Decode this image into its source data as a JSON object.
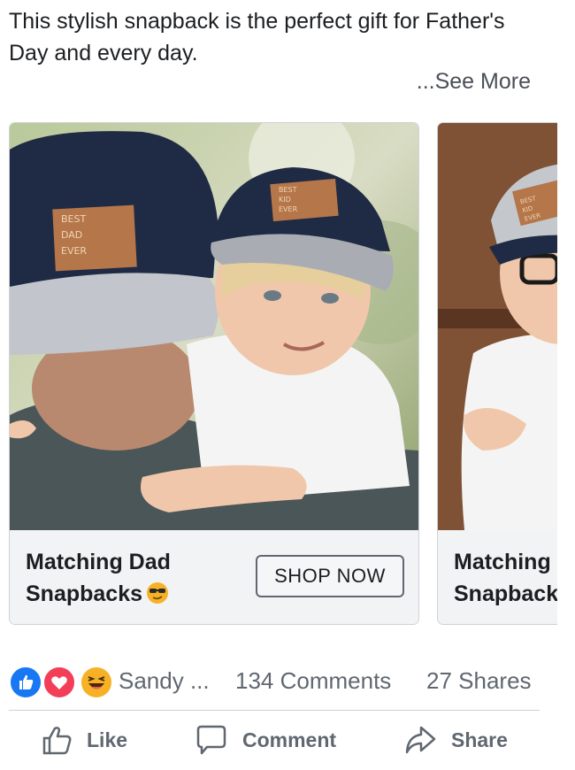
{
  "post": {
    "text": "This stylish snapback is the perfect gift for Father's Day and every day.",
    "see_more": "...See More"
  },
  "carousel": {
    "cards": [
      {
        "title": "Matching Dad\nSnapbacks",
        "emoji": "sunglasses-emoji",
        "cta": "SHOP NOW",
        "image": "photo-father-and-son-in-matching-snapbacks",
        "patch_adult": [
          "BEST",
          "DAD",
          "EVER"
        ],
        "patch_child": [
          "BEST",
          "KID",
          "EVER"
        ]
      },
      {
        "title": "Matching\nSnapback",
        "image": "photo-boy-in-gray-snapback",
        "patch_child": [
          "BEST",
          "KID",
          "EVER"
        ]
      }
    ]
  },
  "reactions": {
    "icons": [
      "like-reaction-icon",
      "love-reaction-icon",
      "haha-reaction-icon"
    ],
    "names": "Sandy ...",
    "comments": "134 Comments",
    "shares": "27 Shares"
  },
  "actions": {
    "like": "Like",
    "comment": "Comment",
    "share": "Share"
  },
  "colors": {
    "link_gray": "#4b4f56",
    "action_gray": "#606770",
    "like_blue": "#1877f2",
    "love_red": "#f33e58",
    "haha_yellow": "#f7b125",
    "card_bg": "#f2f3f5"
  }
}
